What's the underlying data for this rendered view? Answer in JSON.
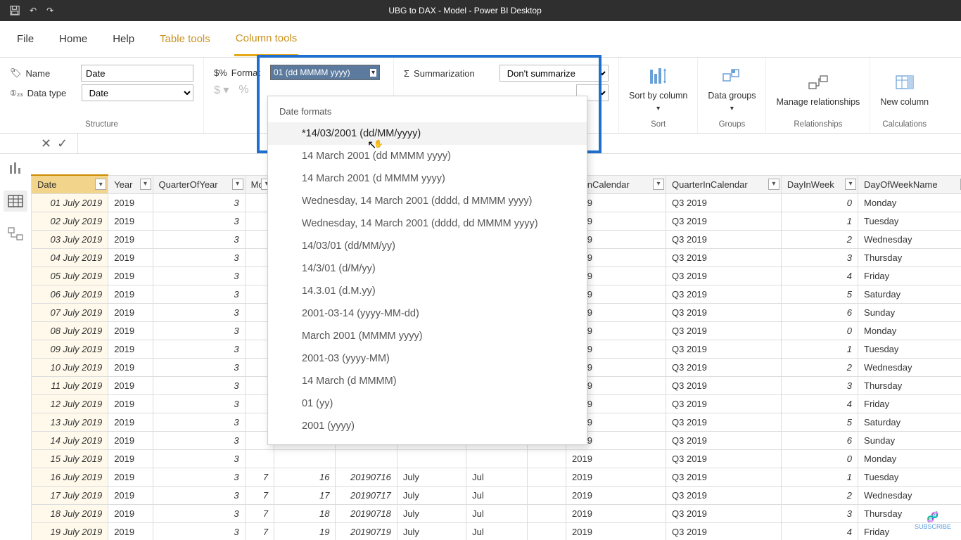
{
  "titlebar": {
    "title": "UBG to DAX - Model - Power BI Desktop"
  },
  "tabs": {
    "file": "File",
    "home": "Home",
    "help": "Help",
    "table": "Table tools",
    "column": "Column tools"
  },
  "ribbon": {
    "name_label": "Name",
    "name_value": "Date",
    "datatype_label": "Data type",
    "datatype_value": "Date",
    "structure_label": "Structure",
    "format_label": "Format",
    "format_value": "01 (dd MMMM yyyy)",
    "summ_label": "Summarization",
    "summ_value": "Don't summarize",
    "sort_label": "Sort by column",
    "groups_label": "Data groups",
    "rel_label": "Manage relationships",
    "newcol_label": "New column",
    "sort_group": "Sort",
    "groups_group": "Groups",
    "rel_group": "Relationships",
    "calc_group": "Calculations"
  },
  "dropdown": {
    "title": "Date formats",
    "items": [
      "*14/03/2001 (dd/MM/yyyy)",
      "14 March 2001 (dd MMMM yyyy)",
      "14 March 2001 (d MMMM yyyy)",
      "Wednesday, 14 March 2001 (dddd, d MMMM yyyy)",
      "Wednesday, 14 March 2001 (dddd, dd MMMM yyyy)",
      "14/03/01 (dd/MM/yy)",
      "14/3/01 (d/M/yy)",
      "14.3.01 (d.M.yy)",
      "2001-03-14 (yyyy-MM-dd)",
      "March 2001 (MMMM yyyy)",
      "2001-03 (yyyy-MM)",
      "14 March (d MMMM)",
      "01 (yy)",
      "2001 (yyyy)"
    ]
  },
  "columns": [
    "Date",
    "Year",
    "QuarterOfYear",
    "Mo",
    "",
    "",
    "",
    "",
    "",
    "nthInCalendar",
    "QuarterInCalendar",
    "DayInWeek",
    "DayOfWeekName"
  ],
  "rows": [
    {
      "date": "01 July 2019",
      "year": "2019",
      "q": "3",
      "mic": "2019",
      "qic": "Q3 2019",
      "diw": "0",
      "down": "Monday"
    },
    {
      "date": "02 July 2019",
      "year": "2019",
      "q": "3",
      "mic": "2019",
      "qic": "Q3 2019",
      "diw": "1",
      "down": "Tuesday"
    },
    {
      "date": "03 July 2019",
      "year": "2019",
      "q": "3",
      "mic": "2019",
      "qic": "Q3 2019",
      "diw": "2",
      "down": "Wednesday"
    },
    {
      "date": "04 July 2019",
      "year": "2019",
      "q": "3",
      "mic": "2019",
      "qic": "Q3 2019",
      "diw": "3",
      "down": "Thursday"
    },
    {
      "date": "05 July 2019",
      "year": "2019",
      "q": "3",
      "mic": "2019",
      "qic": "Q3 2019",
      "diw": "4",
      "down": "Friday"
    },
    {
      "date": "06 July 2019",
      "year": "2019",
      "q": "3",
      "mic": "2019",
      "qic": "Q3 2019",
      "diw": "5",
      "down": "Saturday"
    },
    {
      "date": "07 July 2019",
      "year": "2019",
      "q": "3",
      "mic": "2019",
      "qic": "Q3 2019",
      "diw": "6",
      "down": "Sunday"
    },
    {
      "date": "08 July 2019",
      "year": "2019",
      "q": "3",
      "mic": "2019",
      "qic": "Q3 2019",
      "diw": "0",
      "down": "Monday"
    },
    {
      "date": "09 July 2019",
      "year": "2019",
      "q": "3",
      "mic": "2019",
      "qic": "Q3 2019",
      "diw": "1",
      "down": "Tuesday"
    },
    {
      "date": "10 July 2019",
      "year": "2019",
      "q": "3",
      "mic": "2019",
      "qic": "Q3 2019",
      "diw": "2",
      "down": "Wednesday"
    },
    {
      "date": "11 July 2019",
      "year": "2019",
      "q": "3",
      "mic": "2019",
      "qic": "Q3 2019",
      "diw": "3",
      "down": "Thursday"
    },
    {
      "date": "12 July 2019",
      "year": "2019",
      "q": "3",
      "mic": "2019",
      "qic": "Q3 2019",
      "diw": "4",
      "down": "Friday"
    },
    {
      "date": "13 July 2019",
      "year": "2019",
      "q": "3",
      "mic": "2019",
      "qic": "Q3 2019",
      "diw": "5",
      "down": "Saturday"
    },
    {
      "date": "14 July 2019",
      "year": "2019",
      "q": "3",
      "mic": "2019",
      "qic": "Q3 2019",
      "diw": "6",
      "down": "Sunday"
    },
    {
      "date": "15 July 2019",
      "year": "2019",
      "q": "3",
      "mic": "2019",
      "qic": "Q3 2019",
      "diw": "0",
      "down": "Monday"
    },
    {
      "date": "16 July 2019",
      "year": "2019",
      "q": "3",
      "m": "7",
      "d": "16",
      "ym": "20190716",
      "mn": "July",
      "ms": "Jul",
      "mic": "2019",
      "qic": "Q3 2019",
      "diw": "1",
      "down": "Tuesday"
    },
    {
      "date": "17 July 2019",
      "year": "2019",
      "q": "3",
      "m": "7",
      "d": "17",
      "ym": "20190717",
      "mn": "July",
      "ms": "Jul",
      "mic": "2019",
      "qic": "Q3 2019",
      "diw": "2",
      "down": "Wednesday"
    },
    {
      "date": "18 July 2019",
      "year": "2019",
      "q": "3",
      "m": "7",
      "d": "18",
      "ym": "20190718",
      "mn": "July",
      "ms": "Jul",
      "mic": "2019",
      "qic": "Q3 2019",
      "diw": "3",
      "down": "Thursday"
    },
    {
      "date": "19 July 2019",
      "year": "2019",
      "q": "3",
      "m": "7",
      "d": "19",
      "ym": "20190719",
      "mn": "July",
      "ms": "Jul",
      "mic": "2019",
      "qic": "Q3 2019",
      "diw": "4",
      "down": "Friday"
    }
  ],
  "subscribe": "SUBSCRIBE"
}
